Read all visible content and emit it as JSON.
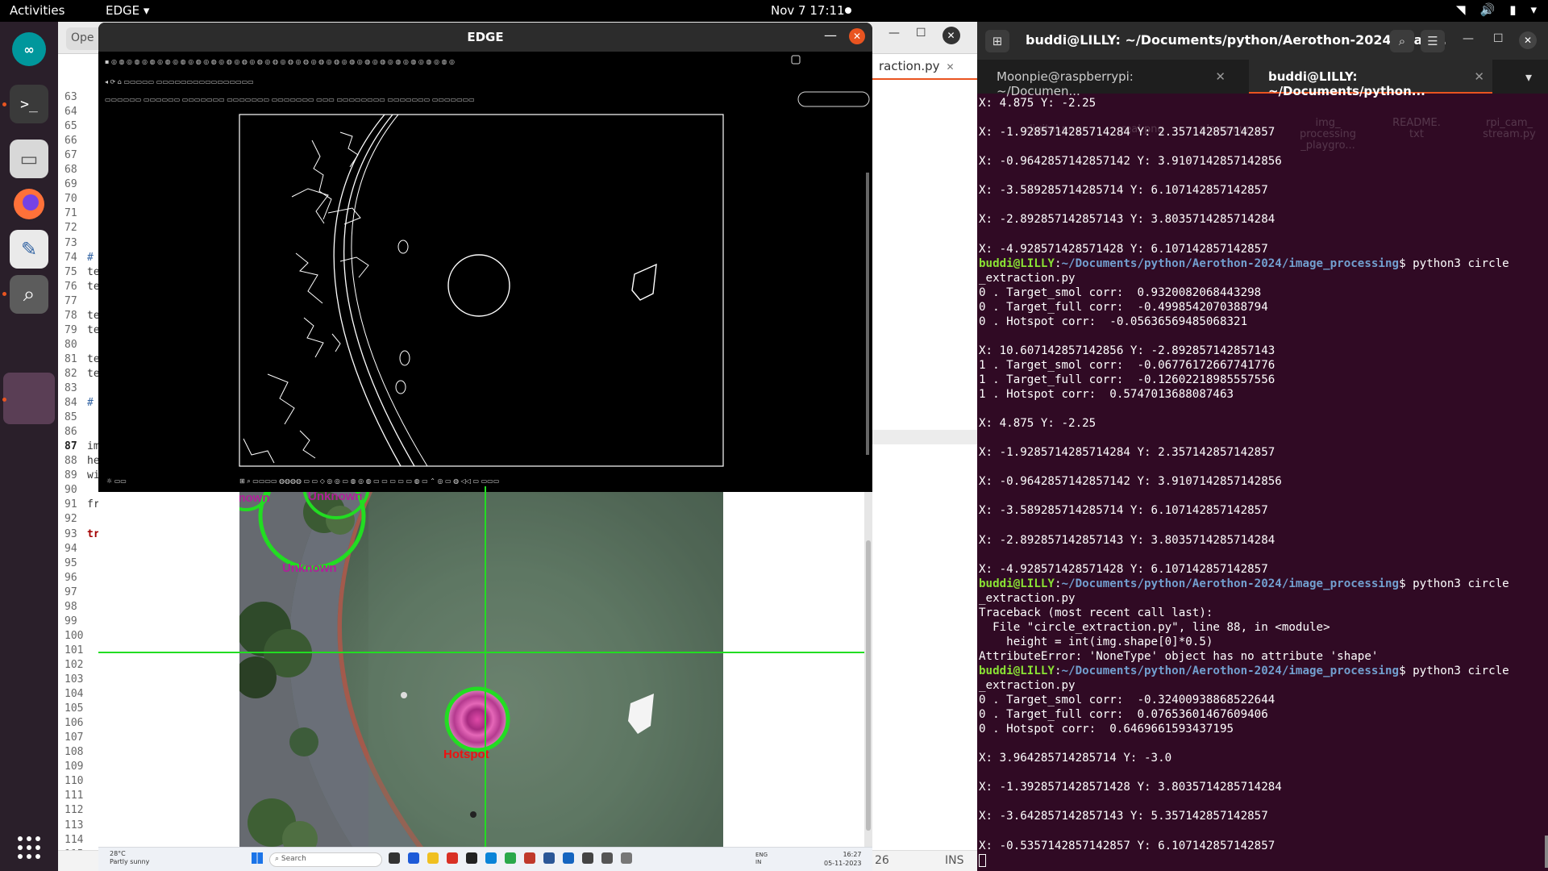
{
  "topbar": {
    "activities": "Activities",
    "app_menu": "EDGE ▾",
    "clock": "Nov 7  17:11"
  },
  "editor": {
    "open_tab": "Ope",
    "right_tab": "raction.py",
    "status_line": "26",
    "status_ins": "INS",
    "lines": [
      {
        "n": "63",
        "t": ""
      },
      {
        "n": "64",
        "t": ""
      },
      {
        "n": "65",
        "t": ""
      },
      {
        "n": "66",
        "t": ""
      },
      {
        "n": "67",
        "t": ""
      },
      {
        "n": "68",
        "t": ""
      },
      {
        "n": "69",
        "t": ""
      },
      {
        "n": "70",
        "t": ""
      },
      {
        "n": "71",
        "t": ""
      },
      {
        "n": "72",
        "t": ""
      },
      {
        "n": "73",
        "t": ""
      },
      {
        "n": "74",
        "t": "#"
      },
      {
        "n": "75",
        "t": "te"
      },
      {
        "n": "76",
        "t": "te"
      },
      {
        "n": "77",
        "t": ""
      },
      {
        "n": "78",
        "t": "te"
      },
      {
        "n": "79",
        "t": "te"
      },
      {
        "n": "80",
        "t": ""
      },
      {
        "n": "81",
        "t": "te"
      },
      {
        "n": "82",
        "t": "te"
      },
      {
        "n": "83",
        "t": ""
      },
      {
        "n": "84",
        "t": "#"
      },
      {
        "n": "85",
        "t": ""
      },
      {
        "n": "86",
        "t": ""
      },
      {
        "n": "87",
        "t": "im"
      },
      {
        "n": "88",
        "t": "he"
      },
      {
        "n": "89",
        "t": "wi"
      },
      {
        "n": "90",
        "t": ""
      },
      {
        "n": "91",
        "t": "fr"
      },
      {
        "n": "92",
        "t": ""
      },
      {
        "n": "93",
        "t": "tr"
      },
      {
        "n": "94",
        "t": ""
      },
      {
        "n": "95",
        "t": ""
      },
      {
        "n": "96",
        "t": ""
      },
      {
        "n": "97",
        "t": ""
      },
      {
        "n": "98",
        "t": ""
      },
      {
        "n": "99",
        "t": ""
      },
      {
        "n": "100",
        "t": ""
      },
      {
        "n": "101",
        "t": ""
      },
      {
        "n": "102",
        "t": ""
      },
      {
        "n": "103",
        "t": ""
      },
      {
        "n": "104",
        "t": ""
      },
      {
        "n": "105",
        "t": ""
      },
      {
        "n": "106",
        "t": ""
      },
      {
        "n": "107",
        "t": ""
      },
      {
        "n": "108",
        "t": ""
      },
      {
        "n": "109",
        "t": ""
      },
      {
        "n": "110",
        "t": ""
      },
      {
        "n": "111",
        "t": ""
      },
      {
        "n": "112",
        "t": ""
      },
      {
        "n": "113",
        "t": ""
      },
      {
        "n": "114",
        "t": ""
      },
      {
        "n": "115",
        "t": ""
      }
    ]
  },
  "edge_window": {
    "title": "EDGE"
  },
  "feed": {
    "labels": [
      "Unknown",
      "Unknown",
      "Unknown",
      "Hotspot"
    ]
  },
  "win_taskbar": {
    "weather_temp": "28°C",
    "weather_desc": "Partly sunny",
    "search": "Search",
    "lang1": "ENG",
    "lang2": "IN",
    "time": "16:27",
    "date": "05-11-2023"
  },
  "terminal": {
    "title": "buddi@LILLY: ~/Documents/python/Aerothon-2024/imag...",
    "tab1": "Moonpie@raspberrypi: ~/Documen...",
    "tab2": "buddi@LILLY: ~/Documents/python...",
    "ghost_files": [
      "digital.png",
      "real.png",
      "playgroun...",
      "img_\nprocessing\n_playgro...",
      "README.\ntxt",
      "rpi_cam_\nstream.py"
    ],
    "lines": [
      "X: 4.875 Y: -2.25",
      "",
      "X: -1.9285714285714284 Y: 2.357142857142857",
      "",
      "X: -0.9642857142857142 Y: 3.9107142857142856",
      "",
      "X: -3.589285714285714 Y: 6.107142857142857",
      "",
      "X: -2.892857142857143 Y: 3.8035714285714284",
      "",
      "X: -4.928571428571428 Y: 6.107142857142857",
      "PROMPT|python3 circle",
      "_extraction.py",
      "0 . Target_smol corr:  0.9320082068443298",
      "0 . Target_full corr:  -0.4998542070388794",
      "0 . Hotspot corr:  -0.05636569485068321",
      "",
      "X: 10.607142857142856 Y: -2.892857142857143",
      "1 . Target_smol corr:  -0.06776172667741776",
      "1 . Target_full corr:  -0.12602218985557556",
      "1 . Hotspot corr:  0.5747013688087463",
      "",
      "X: 4.875 Y: -2.25",
      "",
      "X: -1.9285714285714284 Y: 2.357142857142857",
      "",
      "X: -0.9642857142857142 Y: 3.9107142857142856",
      "",
      "X: -3.589285714285714 Y: 6.107142857142857",
      "",
      "X: -2.892857142857143 Y: 3.8035714285714284",
      "",
      "X: -4.928571428571428 Y: 6.107142857142857",
      "PROMPT|python3 circle",
      "_extraction.py",
      "Traceback (most recent call last):",
      "  File \"circle_extraction.py\", line 88, in <module>",
      "    height = int(img.shape[0]*0.5)",
      "AttributeError: 'NoneType' object has no attribute 'shape'",
      "PROMPT|python3 circle",
      "_extraction.py",
      "0 . Target_smol corr:  -0.32400938868522644",
      "0 . Target_full corr:  0.07653601467609406",
      "0 . Hotspot corr:  0.6469661593437195",
      "",
      "X: 3.964285714285714 Y: -3.0",
      "",
      "X: -1.3928571428571428 Y: 3.8035714285714284",
      "",
      "X: -3.642857142857143 Y: 5.357142857142857",
      "",
      "X: -0.5357142857142857 Y: 6.107142857142857",
      "CURSOR"
    ],
    "prompt_user": "buddi@LILLY",
    "prompt_path": "~/Documents/python/Aerothon-2024/image_processing"
  },
  "colors": {
    "terminal_bg": "#300a24",
    "prompt_user": "#8ae234",
    "prompt_path": "#729fcf",
    "detection_green": "#22dd22",
    "label_magenta": "#b0209a",
    "hotspot_red": "#ee1111",
    "ubuntu_orange": "#e95420"
  }
}
